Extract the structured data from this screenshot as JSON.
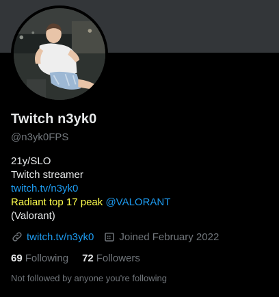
{
  "profile": {
    "display_name": "Twitch n3yk0",
    "handle": "@n3yk0FPS",
    "avatar_icon": "profile-photo",
    "bio": {
      "line1": "21y/SLO",
      "line2": "Twitch streamer",
      "line3_link": "twitch.tv/n3yk0",
      "line4_text": "Radiant top 17 peak",
      "line4_mention": "@VALORANT",
      "line5": "(Valorant)"
    },
    "website": "twitch.tv/n3yk0",
    "joined": "Joined February 2022",
    "following_count": "69",
    "following_label": "Following",
    "followers_count": "72",
    "followers_label": "Followers",
    "followed_note": "Not followed by anyone you're following"
  },
  "colors": {
    "background": "#000000",
    "banner": "#333639",
    "primary_text": "#e7e9ea",
    "secondary_text": "#71767b",
    "link": "#1d9bf0",
    "highlight": "#ffff4d"
  }
}
